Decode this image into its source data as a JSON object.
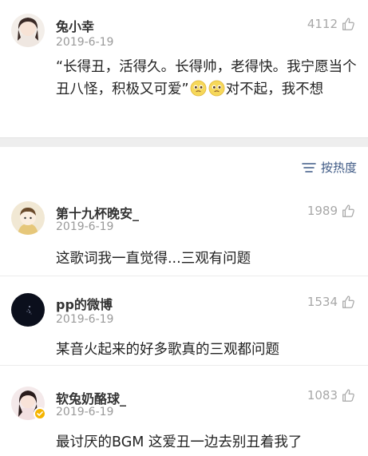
{
  "post": {
    "username": "兔小幸",
    "date": "2019-6-19",
    "like_count": "4112",
    "text_before_emoji": "“长得丑，活得久。长得帅，老得快。我宁愿当个丑八怪，积极又可爱”",
    "text_after_emoji": "对不起，我不想",
    "emoji_icons": [
      "pleading-face-emoji-icon",
      "pleading-face-emoji-icon"
    ]
  },
  "sort": {
    "label": "按热度",
    "icon": "sort-icon"
  },
  "comments": [
    {
      "username": "第十九杯晚安_",
      "date": "2019-6-19",
      "like_count": "1989",
      "text": "这歌词我一直觉得...三观有问题"
    },
    {
      "username": "pp的微博",
      "date": "2019-6-19",
      "like_count": "1534",
      "text": "某音火起来的好多歌真的三观都问题"
    },
    {
      "username": "软兔奶酪球_",
      "date": "2019-6-19",
      "like_count": "1083",
      "text": "最讨厌的BGM 这爱丑一边去别丑着我了",
      "verified": true
    }
  ],
  "colors": {
    "link_blue": "#3f5a85",
    "meta_gray": "#9a9a9a",
    "like_gray": "#a8a8a8",
    "separator": "#eeeeee",
    "verified_badge": "#f5b400"
  }
}
